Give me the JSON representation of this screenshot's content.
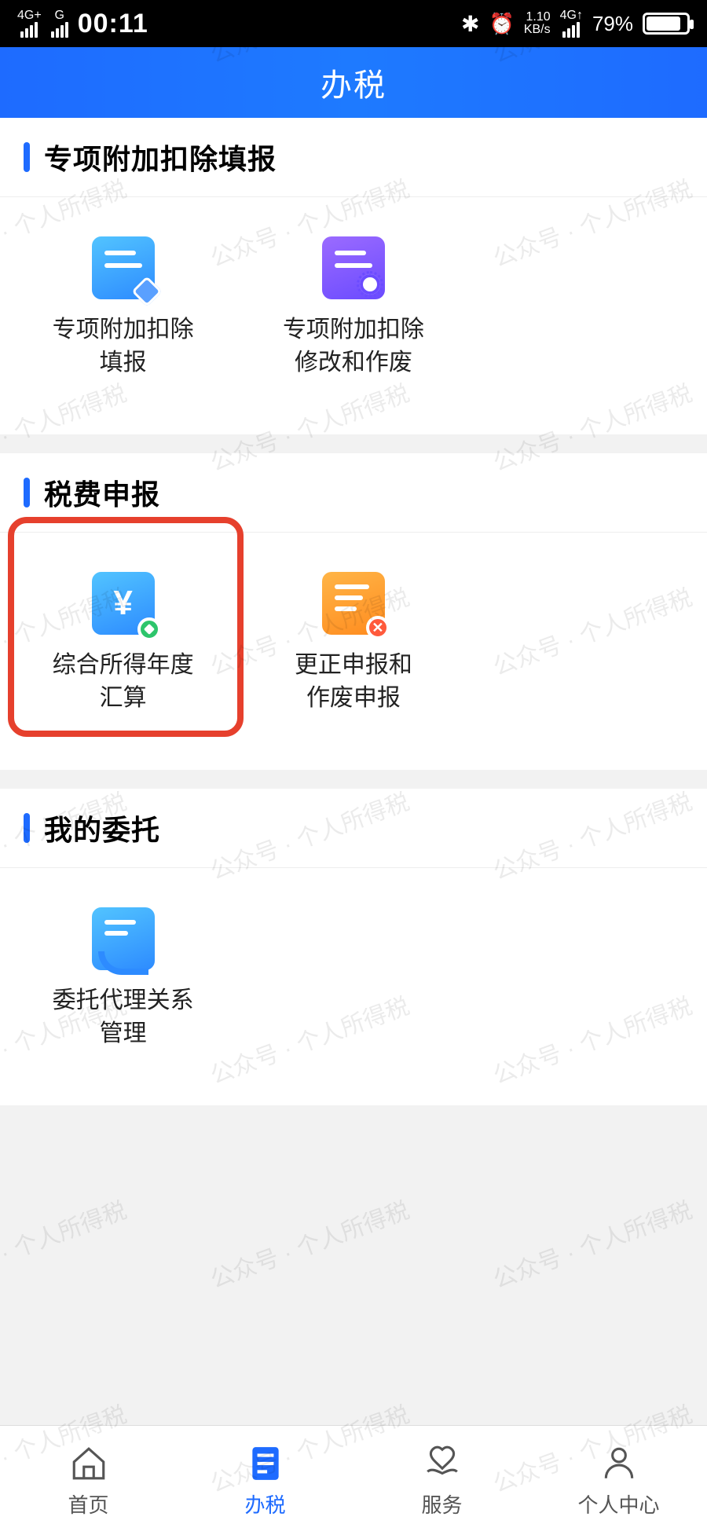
{
  "status": {
    "net1": "4G+",
    "net2": "G",
    "time": "00:11",
    "bt": "✻",
    "alarm": "⏰",
    "speed_top": "1.10",
    "speed_bot": "KB/s",
    "net3": "4G↑",
    "battery": "79%"
  },
  "header": {
    "title": "办税"
  },
  "sections": [
    {
      "title": "专项附加扣除填报",
      "items": [
        {
          "label": "专项附加扣除\n填报",
          "icon": "doc-pencil-blue"
        },
        {
          "label": "专项附加扣除\n修改和作废",
          "icon": "doc-gear-purple"
        }
      ]
    },
    {
      "title": "税费申报",
      "items": [
        {
          "label": "综合所得年度\n汇算",
          "icon": "doc-yen-blue",
          "highlight": true
        },
        {
          "label": "更正申报和\n作废申报",
          "icon": "doc-x-orange"
        }
      ]
    },
    {
      "title": "我的委托",
      "items": [
        {
          "label": "委托代理关系\n管理",
          "icon": "doc-hand-blue"
        }
      ]
    }
  ],
  "nav": {
    "items": [
      {
        "label": "首页",
        "icon": "home"
      },
      {
        "label": "办税",
        "icon": "doc",
        "active": true
      },
      {
        "label": "服务",
        "icon": "heart"
      },
      {
        "label": "个人中心",
        "icon": "person"
      }
    ]
  },
  "watermark": "公众号 · 个人所得税"
}
